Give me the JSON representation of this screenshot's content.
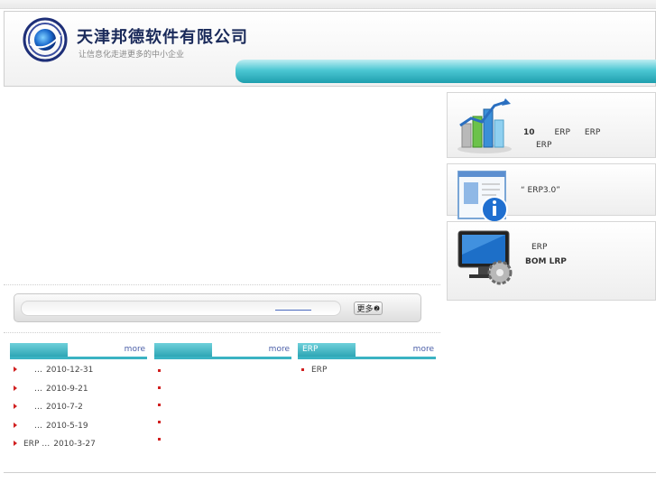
{
  "header": {
    "company_name": "天津邦德软件有限公司",
    "slogan": "让信息化走进更多的中小企业"
  },
  "search": {
    "value": "",
    "placeholder": "",
    "more_label": "更多",
    "more_arrow": "➋"
  },
  "sidebar": {
    "box1": {
      "line1": [
        "10",
        "ERP",
        "ERP"
      ],
      "line2": "ERP",
      "icon": "growth-chart-icon"
    },
    "box2": {
      "line1": "“  ERP3.0”",
      "icon": "info-document-icon"
    },
    "box3": {
      "line1": "ERP",
      "line2": "BOM  LRP",
      "icon": "monitor-gear-icon"
    }
  },
  "news": {
    "columns": [
      {
        "tab": "",
        "more": "more",
        "items": [
          {
            "title": "…",
            "date": "2010-12-31"
          },
          {
            "title": "…",
            "date": "2010-9-21"
          },
          {
            "title": "…",
            "date": "2010-7-2"
          },
          {
            "title": "…",
            "date": "2010-5-19"
          },
          {
            "title": "ERP  …",
            "date": "2010-3-27"
          }
        ]
      },
      {
        "tab": "",
        "more": "more",
        "items": [
          {
            "title": ""
          },
          {
            "title": ""
          },
          {
            "title": ""
          },
          {
            "title": ""
          },
          {
            "title": ""
          }
        ]
      },
      {
        "tab": "ERP",
        "more": "more",
        "items": [
          {
            "title": "ERP"
          }
        ]
      }
    ]
  },
  "colors": {
    "teal": "#3bb3c3",
    "bullet": "#d12020",
    "link": "#4b5fa8",
    "company": "#1a2a5a"
  }
}
